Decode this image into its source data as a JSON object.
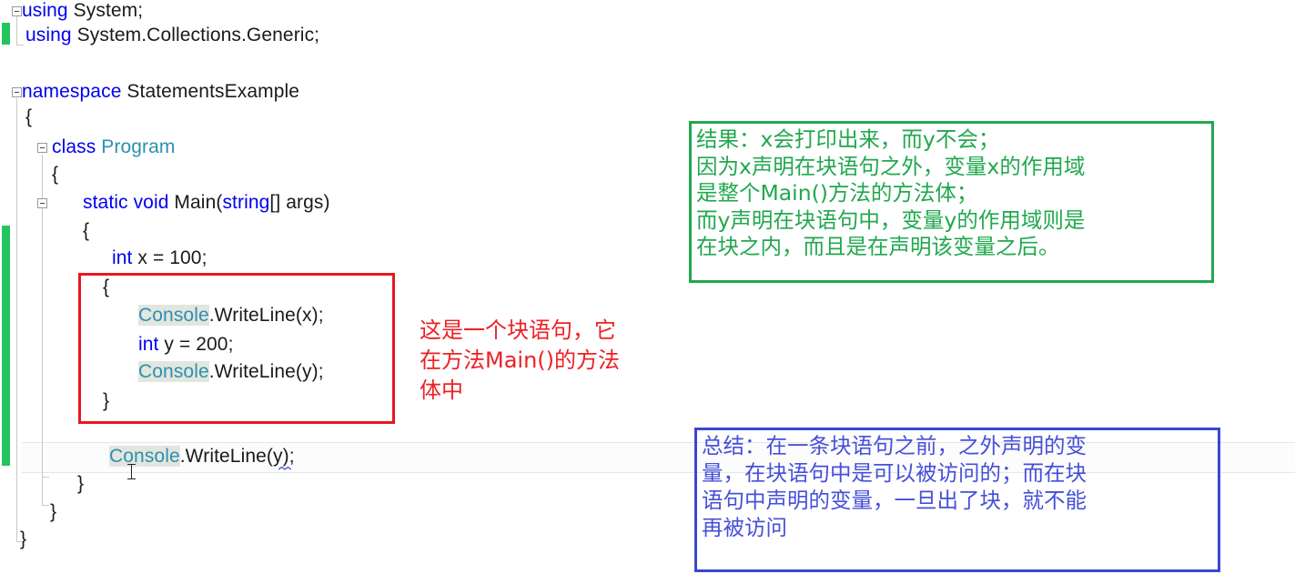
{
  "editor": {
    "language": "csharp",
    "colors": {
      "keyword": "#0000F0",
      "type": "#2B91AF",
      "text": "#1A1A1A",
      "class_highlight_bg": "#E2E6DE",
      "change_bar": "#22C55E",
      "current_line_bg": "#FCFCFC",
      "background": "#FFFFFF"
    },
    "code_lines": [
      {
        "indent": 0,
        "tokens": [
          {
            "t": "using",
            "c": "kw"
          },
          {
            "t": " System;",
            "c": "plain"
          }
        ]
      },
      {
        "indent": 0,
        "tokens": [
          {
            "t": "using",
            "c": "kw"
          },
          {
            "t": " System.Collections.Generic;",
            "c": "plain"
          }
        ]
      },
      {
        "indent": 0,
        "tokens": []
      },
      {
        "indent": 0,
        "tokens": [
          {
            "t": "namespace",
            "c": "kw"
          },
          {
            "t": " StatementsExample",
            "c": "plain"
          }
        ]
      },
      {
        "indent": 0,
        "tokens": [
          {
            "t": "{",
            "c": "plain"
          }
        ]
      },
      {
        "indent": 1,
        "tokens": [
          {
            "t": "class",
            "c": "kw"
          },
          {
            "t": " ",
            "c": "plain"
          },
          {
            "t": "Program",
            "c": "ty"
          }
        ]
      },
      {
        "indent": 1,
        "tokens": [
          {
            "t": "{",
            "c": "plain"
          }
        ]
      },
      {
        "indent": 2,
        "tokens": [
          {
            "t": "static",
            "c": "kw"
          },
          {
            "t": " ",
            "c": "plain"
          },
          {
            "t": "void",
            "c": "kw"
          },
          {
            "t": " Main(",
            "c": "plain"
          },
          {
            "t": "string",
            "c": "kw"
          },
          {
            "t": "[] args)",
            "c": "plain"
          }
        ]
      },
      {
        "indent": 2,
        "tokens": [
          {
            "t": "{",
            "c": "plain"
          }
        ]
      },
      {
        "indent": 3,
        "tokens": [
          {
            "t": "int",
            "c": "kw"
          },
          {
            "t": " x = 100;",
            "c": "plain"
          }
        ]
      },
      {
        "indent": 3,
        "tokens": [
          {
            "t": "{",
            "c": "plain"
          }
        ]
      },
      {
        "indent": 4,
        "tokens": [
          {
            "t": "Console",
            "c": "cls"
          },
          {
            "t": ".WriteLine(x);",
            "c": "plain"
          }
        ]
      },
      {
        "indent": 4,
        "tokens": [
          {
            "t": "int",
            "c": "kw"
          },
          {
            "t": " y = 200;",
            "c": "plain"
          }
        ]
      },
      {
        "indent": 4,
        "tokens": [
          {
            "t": "Console",
            "c": "cls"
          },
          {
            "t": ".WriteLine(y);",
            "c": "plain"
          }
        ]
      },
      {
        "indent": 3,
        "tokens": [
          {
            "t": "}",
            "c": "plain"
          }
        ]
      },
      {
        "indent": 0,
        "tokens": []
      },
      {
        "indent": 4,
        "tokens": [
          {
            "t": "Console",
            "c": "cls"
          },
          {
            "t": ".WriteLine(y);",
            "c": "plain"
          }
        ]
      },
      {
        "indent": 3,
        "tokens": [
          {
            "t": "}",
            "c": "plain"
          }
        ]
      },
      {
        "indent": 2,
        "tokens": [
          {
            "t": "}",
            "c": "plain"
          }
        ]
      },
      {
        "indent": 1,
        "tokens": [
          {
            "t": "}",
            "c": "plain"
          }
        ]
      }
    ],
    "collapse_toggles": [
      {
        "label": "-",
        "name": "collapse-toggle-using"
      },
      {
        "label": "-",
        "name": "collapse-toggle-namespace"
      },
      {
        "label": "-",
        "name": "collapse-toggle-class"
      },
      {
        "label": "-",
        "name": "collapse-toggle-method"
      }
    ]
  },
  "annotations": {
    "red_box": {
      "name": "block-statement-highlight-box",
      "color": "#E8171F"
    },
    "red_note": {
      "text": "这是一个块语句，它\n在方法Main()的方法\n体中",
      "color": "#ED2024"
    },
    "green_note": {
      "text": "结果：x会打印出来，而y不会；\n因为x声明在块语句之外，变量x的作用域\n是整个Main()方法的方法体；\n而y声明在块语句中，变量y的作用域则是\n在块之内，而且是在声明该变量之后。",
      "color": "#21A84E"
    },
    "blue_note": {
      "text": "总结：在一条块语句之前，之外声明的变\n量，在块语句中是可以被访问的；而在块\n语句中声明的变量，一旦出了块，就不能\n再被访问",
      "color": "#3B46CF"
    }
  }
}
